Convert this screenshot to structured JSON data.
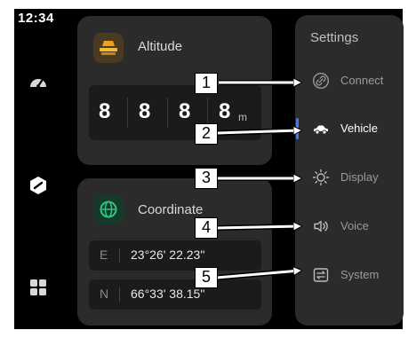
{
  "status_bar": {
    "time": "12:34"
  },
  "nav_rail": {
    "items": [
      {
        "icon": "speedometer-icon"
      },
      {
        "icon": "app-hex-icon"
      },
      {
        "icon": "grid-icon"
      }
    ]
  },
  "altitude_card": {
    "icon": "altitude-icon",
    "title": "Altitude",
    "digits": [
      "8",
      "8",
      "8",
      "8"
    ],
    "unit": "m"
  },
  "coordinate_card": {
    "icon": "globe-icon",
    "title": "Coordinate",
    "rows": [
      {
        "axis": "E",
        "value": "23°26' 22.23\""
      },
      {
        "axis": "N",
        "value": "66°33' 38.15\""
      }
    ]
  },
  "settings_panel": {
    "title": "Settings",
    "active_index": 1,
    "accent_color": "#3d7bff",
    "items": [
      {
        "label": "Connect",
        "icon": "link-icon"
      },
      {
        "label": "Vehicle",
        "icon": "car-icon"
      },
      {
        "label": "Display",
        "icon": "sun-icon"
      },
      {
        "label": "Voice",
        "icon": "speaker-icon"
      },
      {
        "label": "System",
        "icon": "system-icon"
      }
    ]
  },
  "annotations": {
    "callouts": [
      "1",
      "2",
      "3",
      "4",
      "5"
    ]
  }
}
